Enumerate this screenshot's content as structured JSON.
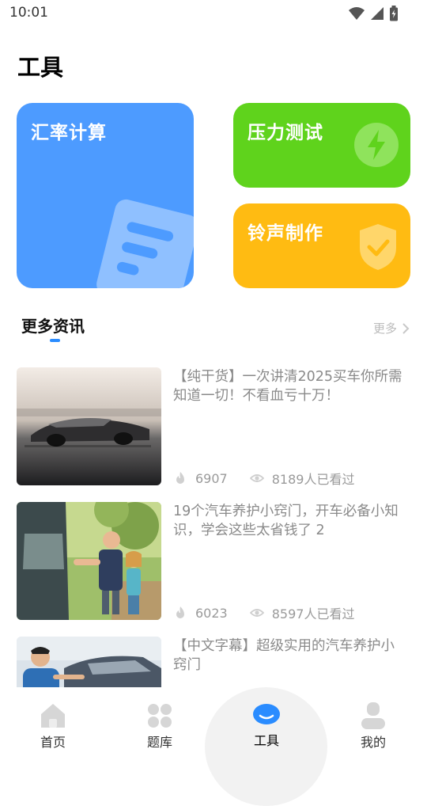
{
  "status_bar": {
    "time": "10:01"
  },
  "page": {
    "title": "工具"
  },
  "tools": [
    {
      "label": "汇率计算",
      "color": "#4d9bff",
      "icon": "document-icon"
    },
    {
      "label": "压力测试",
      "color": "#5fd31c",
      "icon": "lightning-icon"
    },
    {
      "label": "铃声制作",
      "color": "#ffbb12",
      "icon": "shield-check-icon"
    }
  ],
  "section": {
    "title": "更多资讯",
    "more": "更多",
    "accent": "#2a8cff"
  },
  "news": [
    {
      "title": "【纯干货】一次讲清2025买车你所需知道一切！不看血亏十万！",
      "likes": "6907",
      "views": "8189人已看过"
    },
    {
      "title": "19个汽车养护小窍门，开车必备小知识，学会这些太省钱了 2",
      "likes": "6023",
      "views": "8597人已看过"
    },
    {
      "title": "【中文字幕】超级实用的汽车养护小窍门",
      "likes": "",
      "views": ""
    }
  ],
  "tab_bar": {
    "active": "工具",
    "tabs": [
      {
        "label": "首页",
        "icon": "home-icon"
      },
      {
        "label": "题库",
        "icon": "grid-icon"
      },
      {
        "label": "工具",
        "icon": "toolbox-icon"
      },
      {
        "label": "我的",
        "icon": "user-icon"
      }
    ]
  }
}
